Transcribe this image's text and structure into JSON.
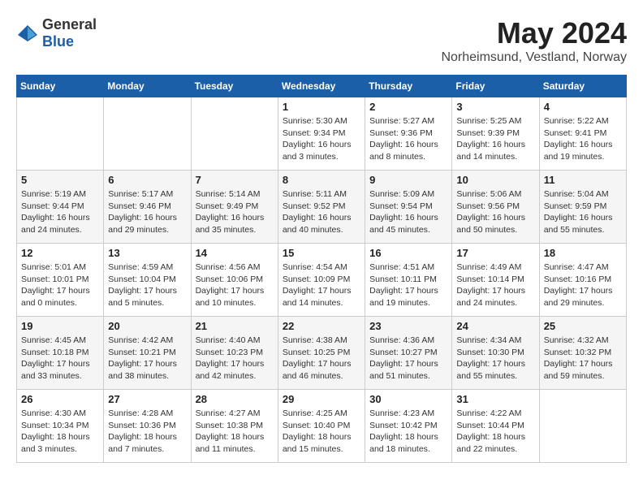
{
  "logo": {
    "general": "General",
    "blue": "Blue"
  },
  "header": {
    "month": "May 2024",
    "location": "Norheimsund, Vestland, Norway"
  },
  "weekdays": [
    "Sunday",
    "Monday",
    "Tuesday",
    "Wednesday",
    "Thursday",
    "Friday",
    "Saturday"
  ],
  "weeks": [
    [
      {
        "day": "",
        "info": ""
      },
      {
        "day": "",
        "info": ""
      },
      {
        "day": "",
        "info": ""
      },
      {
        "day": "1",
        "info": "Sunrise: 5:30 AM\nSunset: 9:34 PM\nDaylight: 16 hours and 3 minutes."
      },
      {
        "day": "2",
        "info": "Sunrise: 5:27 AM\nSunset: 9:36 PM\nDaylight: 16 hours and 8 minutes."
      },
      {
        "day": "3",
        "info": "Sunrise: 5:25 AM\nSunset: 9:39 PM\nDaylight: 16 hours and 14 minutes."
      },
      {
        "day": "4",
        "info": "Sunrise: 5:22 AM\nSunset: 9:41 PM\nDaylight: 16 hours and 19 minutes."
      }
    ],
    [
      {
        "day": "5",
        "info": "Sunrise: 5:19 AM\nSunset: 9:44 PM\nDaylight: 16 hours and 24 minutes."
      },
      {
        "day": "6",
        "info": "Sunrise: 5:17 AM\nSunset: 9:46 PM\nDaylight: 16 hours and 29 minutes."
      },
      {
        "day": "7",
        "info": "Sunrise: 5:14 AM\nSunset: 9:49 PM\nDaylight: 16 hours and 35 minutes."
      },
      {
        "day": "8",
        "info": "Sunrise: 5:11 AM\nSunset: 9:52 PM\nDaylight: 16 hours and 40 minutes."
      },
      {
        "day": "9",
        "info": "Sunrise: 5:09 AM\nSunset: 9:54 PM\nDaylight: 16 hours and 45 minutes."
      },
      {
        "day": "10",
        "info": "Sunrise: 5:06 AM\nSunset: 9:56 PM\nDaylight: 16 hours and 50 minutes."
      },
      {
        "day": "11",
        "info": "Sunrise: 5:04 AM\nSunset: 9:59 PM\nDaylight: 16 hours and 55 minutes."
      }
    ],
    [
      {
        "day": "12",
        "info": "Sunrise: 5:01 AM\nSunset: 10:01 PM\nDaylight: 17 hours and 0 minutes."
      },
      {
        "day": "13",
        "info": "Sunrise: 4:59 AM\nSunset: 10:04 PM\nDaylight: 17 hours and 5 minutes."
      },
      {
        "day": "14",
        "info": "Sunrise: 4:56 AM\nSunset: 10:06 PM\nDaylight: 17 hours and 10 minutes."
      },
      {
        "day": "15",
        "info": "Sunrise: 4:54 AM\nSunset: 10:09 PM\nDaylight: 17 hours and 14 minutes."
      },
      {
        "day": "16",
        "info": "Sunrise: 4:51 AM\nSunset: 10:11 PM\nDaylight: 17 hours and 19 minutes."
      },
      {
        "day": "17",
        "info": "Sunrise: 4:49 AM\nSunset: 10:14 PM\nDaylight: 17 hours and 24 minutes."
      },
      {
        "day": "18",
        "info": "Sunrise: 4:47 AM\nSunset: 10:16 PM\nDaylight: 17 hours and 29 minutes."
      }
    ],
    [
      {
        "day": "19",
        "info": "Sunrise: 4:45 AM\nSunset: 10:18 PM\nDaylight: 17 hours and 33 minutes."
      },
      {
        "day": "20",
        "info": "Sunrise: 4:42 AM\nSunset: 10:21 PM\nDaylight: 17 hours and 38 minutes."
      },
      {
        "day": "21",
        "info": "Sunrise: 4:40 AM\nSunset: 10:23 PM\nDaylight: 17 hours and 42 minutes."
      },
      {
        "day": "22",
        "info": "Sunrise: 4:38 AM\nSunset: 10:25 PM\nDaylight: 17 hours and 46 minutes."
      },
      {
        "day": "23",
        "info": "Sunrise: 4:36 AM\nSunset: 10:27 PM\nDaylight: 17 hours and 51 minutes."
      },
      {
        "day": "24",
        "info": "Sunrise: 4:34 AM\nSunset: 10:30 PM\nDaylight: 17 hours and 55 minutes."
      },
      {
        "day": "25",
        "info": "Sunrise: 4:32 AM\nSunset: 10:32 PM\nDaylight: 17 hours and 59 minutes."
      }
    ],
    [
      {
        "day": "26",
        "info": "Sunrise: 4:30 AM\nSunset: 10:34 PM\nDaylight: 18 hours and 3 minutes."
      },
      {
        "day": "27",
        "info": "Sunrise: 4:28 AM\nSunset: 10:36 PM\nDaylight: 18 hours and 7 minutes."
      },
      {
        "day": "28",
        "info": "Sunrise: 4:27 AM\nSunset: 10:38 PM\nDaylight: 18 hours and 11 minutes."
      },
      {
        "day": "29",
        "info": "Sunrise: 4:25 AM\nSunset: 10:40 PM\nDaylight: 18 hours and 15 minutes."
      },
      {
        "day": "30",
        "info": "Sunrise: 4:23 AM\nSunset: 10:42 PM\nDaylight: 18 hours and 18 minutes."
      },
      {
        "day": "31",
        "info": "Sunrise: 4:22 AM\nSunset: 10:44 PM\nDaylight: 18 hours and 22 minutes."
      },
      {
        "day": "",
        "info": ""
      }
    ]
  ]
}
